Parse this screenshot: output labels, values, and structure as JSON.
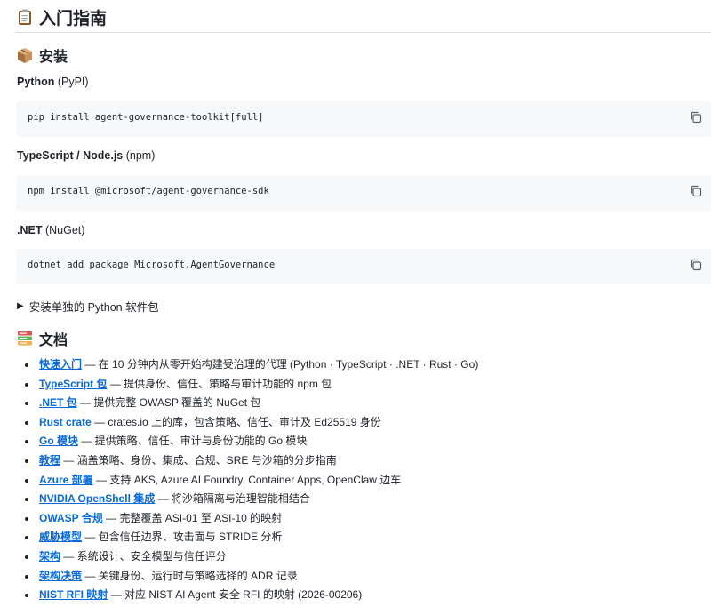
{
  "title": "入门指南",
  "install": {
    "heading": "安装",
    "packages": [
      {
        "name": "Python",
        "registry": "(PyPI)",
        "command": "pip install agent-governance-toolkit[full]"
      },
      {
        "name": "TypeScript / Node.js",
        "registry": "(npm)",
        "command": "npm install @microsoft/agent-governance-sdk"
      },
      {
        "name": ".NET",
        "registry": "(NuGet)",
        "command": "dotnet add package Microsoft.AgentGovernance"
      }
    ],
    "details_summary": "安装单独的 Python 软件包"
  },
  "docs": {
    "heading": "文档",
    "items": [
      {
        "link": "快速入门",
        "desc": " — 在 10 分钟内从零开始构建受治理的代理 (Python · TypeScript · .NET · Rust · Go)"
      },
      {
        "link": "TypeScript 包",
        "desc": " — 提供身份、信任、策略与审计功能的 npm 包"
      },
      {
        "link": ".NET 包",
        "desc": " — 提供完整 OWASP 覆盖的 NuGet 包"
      },
      {
        "link": "Rust crate",
        "desc": " — crates.io 上的库，包含策略、信任、审计及 Ed25519 身份"
      },
      {
        "link": "Go 模块",
        "desc": " — 提供策略、信任、审计与身份功能的 Go 模块"
      },
      {
        "link": "教程",
        "desc": " — 涵盖策略、身份、集成、合规、SRE 与沙箱的分步指南"
      },
      {
        "link": "Azure 部署",
        "desc": " — 支持 AKS, Azure AI Foundry, Container Apps, OpenClaw 边车"
      },
      {
        "link": "NVIDIA OpenShell 集成",
        "desc": " — 将沙箱隔离与治理智能相结合"
      },
      {
        "link": "OWASP 合规",
        "desc": " — 完整覆盖 ASI-01 至 ASI-10 的映射"
      },
      {
        "link": "威胁模型",
        "desc": " — 包含信任边界、攻击面与 STRIDE 分析"
      },
      {
        "link": "架构",
        "desc": " — 系统设计、安全模型与信任评分"
      },
      {
        "link": "架构决策",
        "desc": " — 关键身份、运行时与策略选择的 ADR 记录"
      },
      {
        "link": "NIST RFI 映射",
        "desc": " — 对应 NIST AI Agent 安全 RFI 的映射 (2026-00206)"
      }
    ]
  }
}
